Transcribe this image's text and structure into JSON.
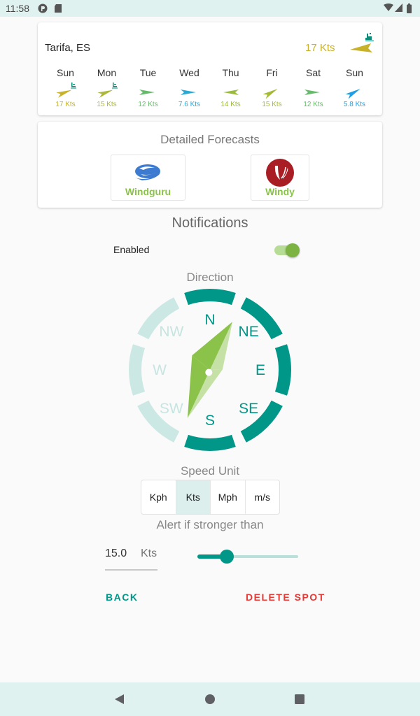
{
  "status_bar": {
    "time": "11:58",
    "icons": [
      "app-notification-icon",
      "sd-card-icon",
      "wifi-icon",
      "signal-icon",
      "battery-icon"
    ]
  },
  "spot": {
    "name": "Tarifa, ES",
    "current_speed": "17 Kts",
    "current_color": "#c8b22a",
    "kite_icon": "kitesurfer-icon"
  },
  "forecast": [
    {
      "day": "Sun",
      "speed": "17 Kts",
      "color": "#c8b22a",
      "direction_deg": 250,
      "kite": true
    },
    {
      "day": "Mon",
      "speed": "15 Kts",
      "color": "#adb83a",
      "direction_deg": 250,
      "kite": true
    },
    {
      "day": "Tue",
      "speed": "12 Kts",
      "color": "#66bb6a",
      "direction_deg": 270,
      "kite": false
    },
    {
      "day": "Wed",
      "speed": "7.6 Kts",
      "color": "#29a9d6",
      "direction_deg": 270,
      "kite": false
    },
    {
      "day": "Thu",
      "speed": "14 Kts",
      "color": "#9bbb3c",
      "direction_deg": 90,
      "kite": false
    },
    {
      "day": "Fri",
      "speed": "15 Kts",
      "color": "#a6b935",
      "direction_deg": 240,
      "kite": false
    },
    {
      "day": "Sat",
      "speed": "12 Kts",
      "color": "#66bb6a",
      "direction_deg": 270,
      "kite": false
    },
    {
      "day": "Sun",
      "speed": "5.8 Kts",
      "color": "#1e9ee6",
      "direction_deg": 240,
      "kite": false
    }
  ],
  "detailed_forecasts": {
    "title": "Detailed Forecasts",
    "providers": [
      {
        "label": "Windguru",
        "icon": "windguru-logo-icon"
      },
      {
        "label": "Windy",
        "icon": "windy-logo-icon"
      }
    ]
  },
  "notifications": {
    "title": "Notifications",
    "enabled_label": "Enabled",
    "enabled": true,
    "direction_title": "Direction",
    "directions": [
      {
        "label": "N",
        "selected": true
      },
      {
        "label": "NE",
        "selected": true
      },
      {
        "label": "E",
        "selected": true
      },
      {
        "label": "SE",
        "selected": true
      },
      {
        "label": "S",
        "selected": true
      },
      {
        "label": "SW",
        "selected": false
      },
      {
        "label": "W",
        "selected": false
      },
      {
        "label": "NW",
        "selected": false
      }
    ],
    "needle_direction_deg": 25,
    "speed_unit_title": "Speed Unit",
    "speed_units": [
      "Kph",
      "Kts",
      "Mph",
      "m/s"
    ],
    "selected_unit": "Kts",
    "alert_title": "Alert if stronger than",
    "threshold_value": "15.0",
    "threshold_unit": "Kts",
    "slider_fraction": 0.29
  },
  "actions": {
    "back": "BACK",
    "delete": "DELETE SPOT"
  },
  "colors": {
    "accent": "#009688",
    "accent_light": "#cce8e4",
    "green": "#7cb342",
    "danger": "#e53935"
  }
}
